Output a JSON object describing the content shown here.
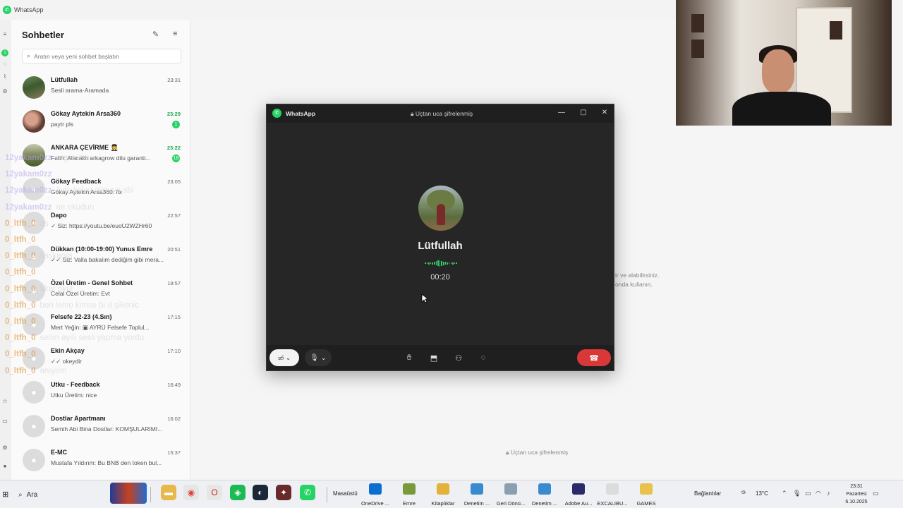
{
  "app_title": "WhatsApp",
  "sidebar": {
    "title": "Sohbetler",
    "search_placeholder": "Aratın veya yeni sohbet başlatın",
    "chats": [
      {
        "name": "Lütfullah",
        "time": "23:31",
        "message": "Sesli arama·Aramada",
        "avatar": "photo1",
        "unread": ""
      },
      {
        "name": "Gökay Aytekin Arsa360",
        "time": "23:29",
        "message": "paytr pls",
        "avatar": "photo2",
        "unread": "1"
      },
      {
        "name": "ANKARA ÇEVİRME 🧑‍✈️",
        "time": "23:22",
        "message": "Fatih: Alacaklı arkagrow dilu garanti...",
        "avatar": "photo3",
        "unread": "18"
      },
      {
        "name": "Gökay Feedback",
        "time": "23:05",
        "message": "Gökay Aytekin Arsa360: fix",
        "avatar": "group",
        "unread": ""
      },
      {
        "name": "Dapo",
        "time": "22:57",
        "message": "✓ Siz: https://youtu.be/euoU2WZHr60",
        "avatar": "group",
        "unread": ""
      },
      {
        "name": "Dükkan (10:00-19:00) Yunus Emre",
        "time": "20:51",
        "message": "✓✓ Siz: Valla bakalım dediğim gibi mera...",
        "avatar": "group",
        "unread": ""
      },
      {
        "name": "Özel Üretim - Genel Sohbet",
        "time": "19:57",
        "message": "Celal Özel Üretim: Evt",
        "avatar": "group",
        "unread": ""
      },
      {
        "name": "Felsefe 22-23 (4.Sın)",
        "time": "17:15",
        "message": "Mert Yeğin: ▣ AYRÜ Felsefe Toplul...",
        "avatar": "group",
        "unread": ""
      },
      {
        "name": "Ekin Akçay",
        "time": "17:10",
        "message": "✓✓ okeydir",
        "avatar": "group",
        "unread": ""
      },
      {
        "name": "Utku - Feedback",
        "time": "16:49",
        "message": "Utku Üretim: nice",
        "avatar": "group",
        "unread": ""
      },
      {
        "name": "Dostlar Apartmanı",
        "time": "16:02",
        "message": "Semih Abi Bina Dostlar: KOMŞULARIMI...",
        "avatar": "group",
        "unread": ""
      },
      {
        "name": "E-MC",
        "time": "15:37",
        "message": "Mustafa Yıldırım: Bu BNB den token bul...",
        "avatar": "group",
        "unread": ""
      }
    ]
  },
  "stream_chat": [
    {
      "user": "12yakam0zz",
      "text": "organizm",
      "color": "purple"
    },
    {
      "user": "12yakam0zz",
      "text": "",
      "color": "purple"
    },
    {
      "user": "12yakam0zz",
      "text": "öyle kolay olmuyo abi",
      "color": "purple"
    },
    {
      "user": "12yakam0zz",
      "text": "ne okudun",
      "color": "purple"
    },
    {
      "user": "0_ltfh_0",
      "text": "as",
      "color": "orange"
    },
    {
      "user": "0_ltfh_0",
      "text": "",
      "color": "orange"
    },
    {
      "user": "0_ltfh_0",
      "text": "saskarya",
      "color": "orange"
    },
    {
      "user": "0_ltfh_0",
      "text": "",
      "color": "orange"
    },
    {
      "user": "0_ltfh_0",
      "text": "akar okul",
      "color": "orange"
    },
    {
      "user": "0_ltfh_0",
      "text": "ben lemo kimse bi d şikonic",
      "color": "orange"
    },
    {
      "user": "0_ltfh_0",
      "text": "",
      "color": "orange"
    },
    {
      "user": "0_ltfh_0",
      "text": "senin ayılı sesli yapma yordu",
      "color": "orange"
    },
    {
      "user": "0_ltfh_0",
      "text": "",
      "color": "orange"
    },
    {
      "user": "0_ltfh_0",
      "text": "anıyom",
      "color": "orange"
    }
  ],
  "main_pane": {
    "hint_line1": "ir ve alabilirsiniz.",
    "hint_line2": "onda kullanın.",
    "footer": "Uçtan uca şifrelenmiş"
  },
  "call": {
    "app": "WhatsApp",
    "encryption": "Uçtan uca şifrelenmiş",
    "contact": "Lütfullah",
    "timer": "00:20"
  },
  "taskbar": {
    "search": "Ara",
    "masaustu": "Masaüstü",
    "pinned_labeled": [
      {
        "label": "OneDrive ...",
        "color": "#0a6fd1"
      },
      {
        "label": "Emre",
        "color": "#7a9a3a"
      },
      {
        "label": "Kitaplıklar",
        "color": "#e3b23a"
      },
      {
        "label": "Denetim ...",
        "color": "#3a8ad1"
      },
      {
        "label": "Geri Dönü...",
        "color": "#8aa0b0"
      },
      {
        "label": "Denetim ...",
        "color": "#3a8ad1"
      },
      {
        "label": "Adobe Au...",
        "color": "#2a2a6a"
      },
      {
        "label": "EXCALIBU...",
        "color": "#dcdcdc"
      },
      {
        "label": "GAMES",
        "color": "#e8c24a"
      }
    ],
    "connections": "Bağlantılar",
    "weather": "13°C",
    "time": "23:31",
    "day": "Pazartesi",
    "date": "6.10.2025"
  }
}
